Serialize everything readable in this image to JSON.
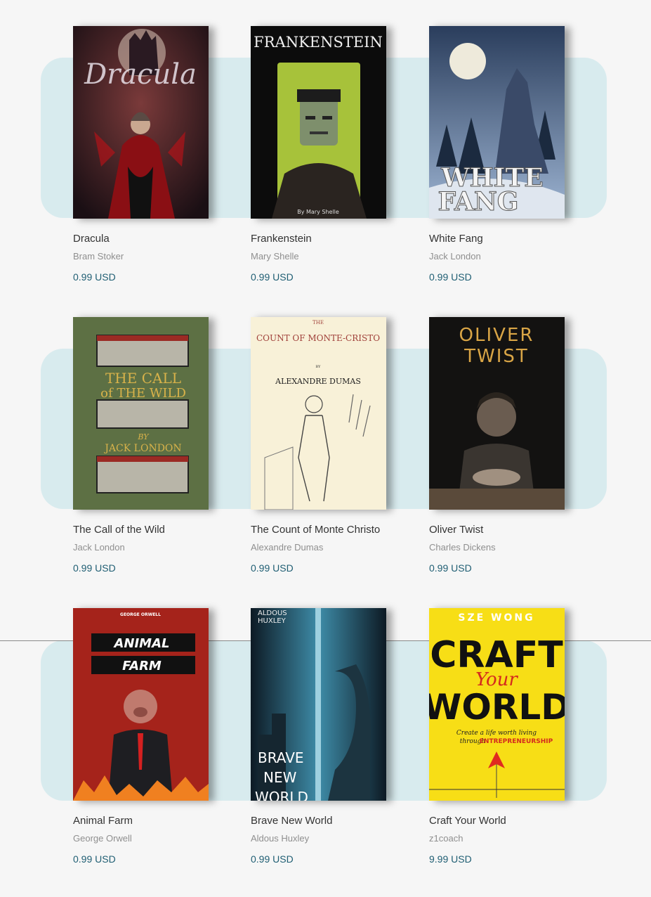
{
  "books": [
    {
      "title": "Dracula",
      "author": "Bram Stoker",
      "price": "0.99 USD",
      "cover_text": [
        "Dracula"
      ]
    },
    {
      "title": "Frankenstein",
      "author": "Mary Shelle",
      "price": "0.99 USD",
      "cover_text": [
        "FRANKENSTEIN",
        "By Mary Shelle"
      ]
    },
    {
      "title": "White Fang",
      "author": "Jack London",
      "price": "0.99 USD",
      "cover_text": [
        "WHITE",
        "FANG"
      ]
    },
    {
      "title": "The Call of the Wild",
      "author": "Jack London",
      "price": "0.99 USD",
      "cover_text": [
        "THE CALL",
        "of THE WILD",
        "BY",
        "JACK LONDON"
      ]
    },
    {
      "title": "The Count of Monte Christo",
      "author": "Alexandre Dumas",
      "price": "0.99 USD",
      "cover_text": [
        "THE",
        "COUNT OF MONTE-CRISTO",
        "BY",
        "ALEXANDRE DUMAS"
      ]
    },
    {
      "title": "Oliver Twist",
      "author": "Charles Dickens",
      "price": "0.99 USD",
      "cover_text": [
        "OLIVER",
        "TWIST"
      ]
    },
    {
      "title": "Animal Farm",
      "author": "George Orwell",
      "price": "0.99 USD",
      "cover_text": [
        "GEORGE ORWELL",
        "ANIMAL",
        "FARM"
      ]
    },
    {
      "title": "Brave New World",
      "author": "Aldous Huxley",
      "price": "0.99 USD",
      "cover_text": [
        "ALDOUS",
        "HUXLEY",
        "BRAVE",
        "NEW",
        "WORLD"
      ]
    },
    {
      "title": "Craft Your World",
      "author": "z1coach",
      "price": "9.99 USD",
      "cover_text": [
        "SZE WONG",
        "CRAFT",
        "Your",
        "WORLD",
        "Create a life worth living",
        "through",
        "ENTREPRENEURSHIP"
      ]
    }
  ],
  "colors": {
    "background": "#f6f6f6",
    "shelf": "#d8ebee",
    "price": "#1f5e73",
    "title": "#333333",
    "author": "#8f8f8f"
  }
}
